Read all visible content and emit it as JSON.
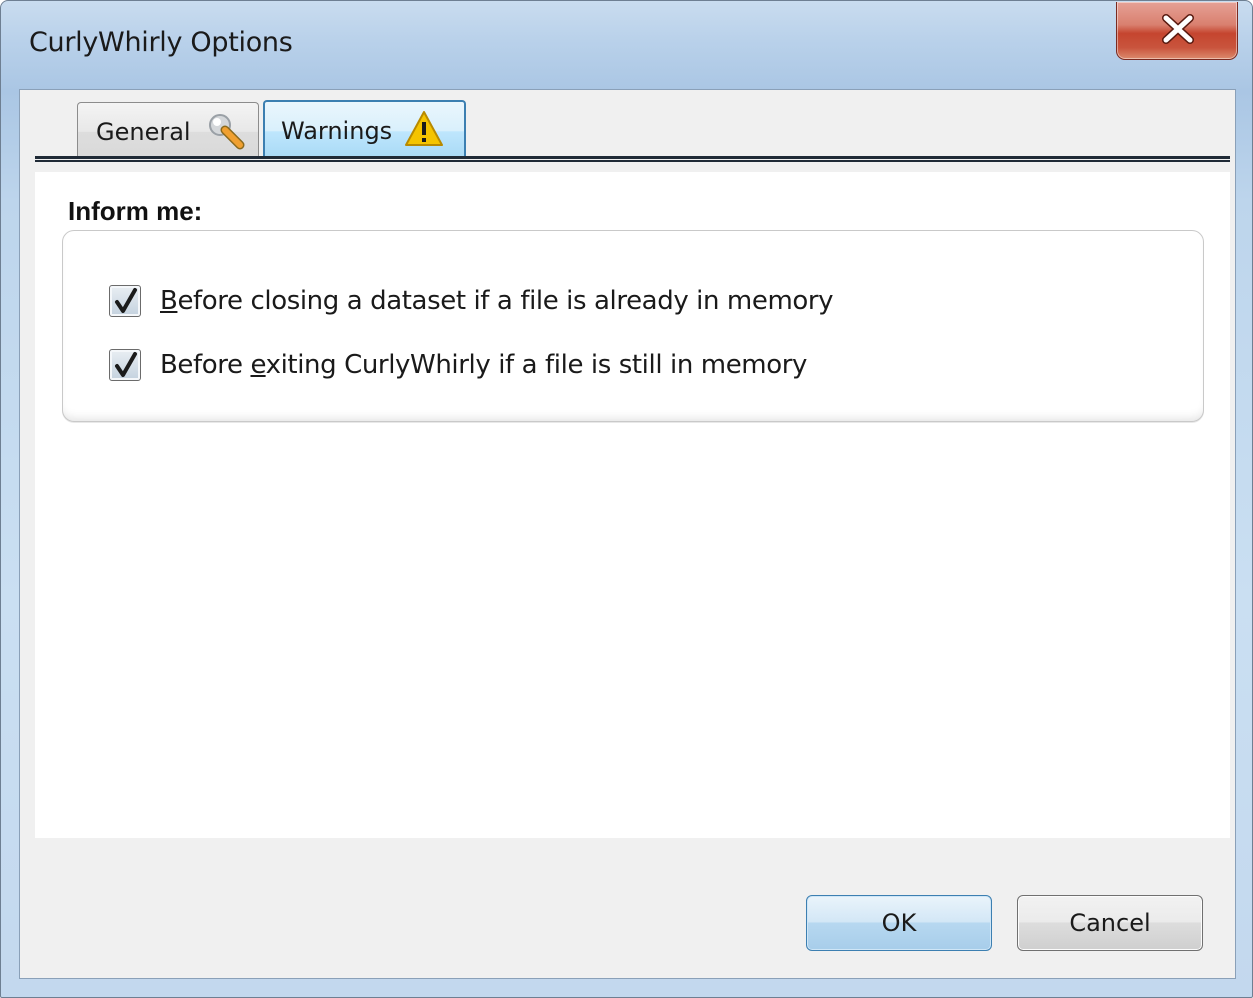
{
  "window": {
    "title": "CurlyWhirly Options",
    "close_icon": "close-x-icon"
  },
  "tabs": [
    {
      "label": "General",
      "icon": "wrench-icon",
      "selected": false
    },
    {
      "label": "Warnings",
      "icon": "warning-triangle-icon",
      "selected": true
    }
  ],
  "warnings_page": {
    "section_label": "Inform me:",
    "options": [
      {
        "prefix": "",
        "mnemonic": "B",
        "rest": "efore closing a dataset if a file is already in memory",
        "checked": true
      },
      {
        "prefix": "Before ",
        "mnemonic": "e",
        "rest": "xiting CurlyWhirly if a file is still in memory",
        "checked": true
      }
    ]
  },
  "buttons": {
    "ok": "OK",
    "cancel": "Cancel"
  },
  "colors": {
    "selected_tab_border": "#3c7fb1",
    "close_button": "#c5452f",
    "warning_icon": "#f5c400"
  }
}
